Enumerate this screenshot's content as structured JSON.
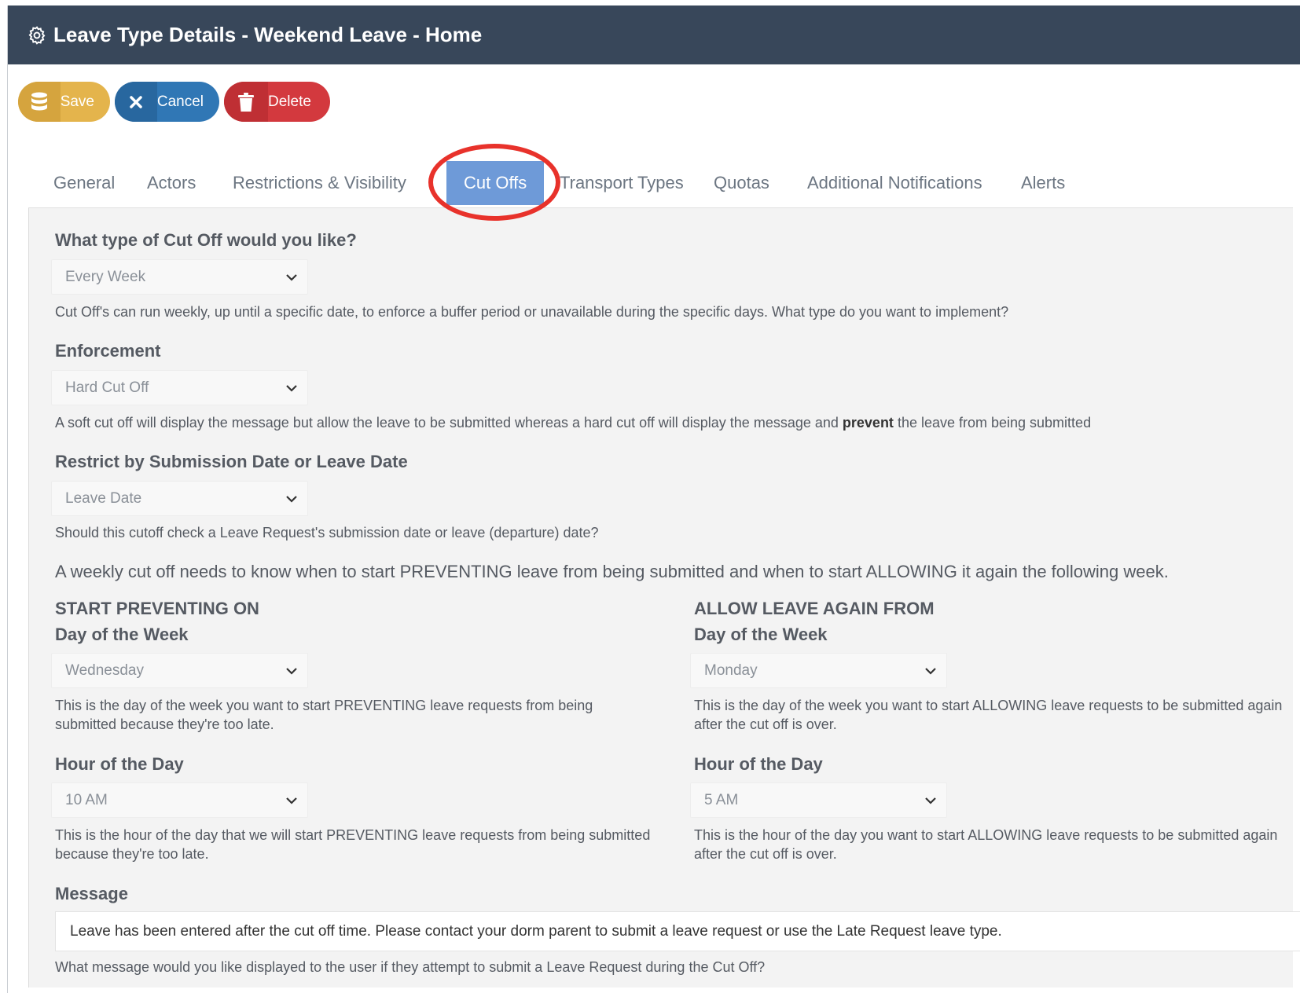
{
  "header": {
    "title": "Leave Type Details - Weekend Leave - Home",
    "icon": "gear-icon"
  },
  "toolbar": {
    "save_label": "Save",
    "cancel_label": "Cancel",
    "delete_label": "Delete"
  },
  "tabs": [
    {
      "label": "General"
    },
    {
      "label": "Actors"
    },
    {
      "label": "Restrictions & Visibility"
    },
    {
      "label": "Cut Offs",
      "active": true
    },
    {
      "label": "Transport Types"
    },
    {
      "label": "Quotas"
    },
    {
      "label": "Additional Notifications"
    },
    {
      "label": "Alerts"
    }
  ],
  "cutoff_type": {
    "label": "What type of Cut Off would you like?",
    "value": "Every Week",
    "help": "Cut Off's can run weekly, up until a specific date, to enforce a buffer period or unavailable during the specific days. What type do you want to implement?"
  },
  "enforcement": {
    "label": "Enforcement",
    "value": "Hard Cut Off",
    "help_before": "A soft cut off will display the message but allow the leave to be submitted whereas a hard cut off will display the message and ",
    "help_bold": "prevent",
    "help_after": " the leave from being submitted"
  },
  "restrict_by": {
    "label": "Restrict by Submission Date or Leave Date",
    "value": "Leave Date",
    "help": "Should this cutoff check a Leave Request's submission date or leave (departure) date?"
  },
  "weekly_intro": "A weekly cut off needs to know when to start PREVENTING leave from being submitted and when to start ALLOWING it again the following week.",
  "start_preventing": {
    "heading": "START PREVENTING ON",
    "day_label": "Day of the Week",
    "day_value": "Wednesday",
    "day_help": "This is the day of the week you want to start PREVENTING leave requests from being submitted because they're too late.",
    "hour_label": "Hour of the Day",
    "hour_value": "10 AM",
    "hour_help": "This is the hour of the day that we will start PREVENTING leave requests from being submitted because they're too late."
  },
  "allow_again": {
    "heading": "ALLOW LEAVE AGAIN FROM",
    "day_label": "Day of the Week",
    "day_value": "Monday",
    "day_help": "This is the day of the week you want to start ALLOWING leave requests to be submitted again after the cut off is over.",
    "hour_label": "Hour of the Day",
    "hour_value": "5 AM",
    "hour_help": "This is the hour of the day you want to start ALLOWING leave requests to be submitted again after the cut off is over."
  },
  "message": {
    "label": "Message",
    "value": "Leave has been entered after the cut off time.  Please contact your dorm parent to submit a leave request or use the Late Request leave type.",
    "help": "What message would you like displayed to the user if they attempt to submit a Leave Request during the Cut Off?"
  },
  "colors": {
    "header_bg": "#38475a",
    "save": "#e4b44c",
    "cancel": "#3077b5",
    "delete": "#d3393e",
    "active_tab": "#6e9ad8",
    "highlight_ring": "#e8322b"
  }
}
